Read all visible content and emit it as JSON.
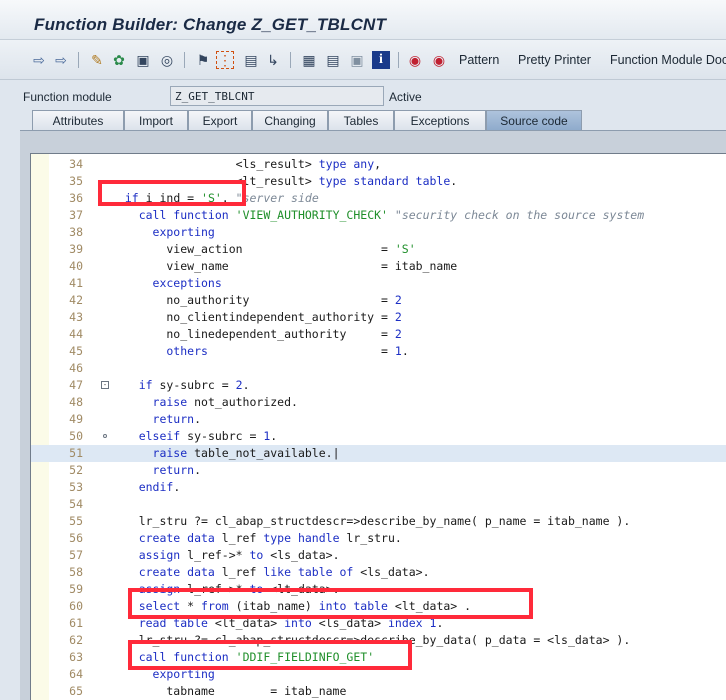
{
  "window": {
    "title": "Function Builder: Change Z_GET_TBLCNT"
  },
  "toolbar": {
    "icons": [
      "back-arrow-icon",
      "forward-arrow-icon",
      "pencil-toggle-icon",
      "other-object-icon",
      "activate-icon",
      "check-icon",
      "where-used-icon",
      "navigate-icon",
      "display-object-list-icon",
      "hierarchy-icon",
      "stack-icon",
      "documentation-icon",
      "info-icon",
      "test-icon",
      "debugger-icon"
    ],
    "pattern_label": "Pattern",
    "pretty_printer_label": "Pretty Printer",
    "function_module_doc_label": "Function Module Doc"
  },
  "header": {
    "fm_label": "Function module",
    "fm_value": "Z_GET_TBLCNT",
    "status": "Active"
  },
  "tabs": [
    {
      "label": "Attributes",
      "active": false
    },
    {
      "label": "Import",
      "active": false
    },
    {
      "label": "Export",
      "active": false
    },
    {
      "label": "Changing",
      "active": false
    },
    {
      "label": "Tables",
      "active": false
    },
    {
      "label": "Exceptions",
      "active": false
    },
    {
      "label": "Source code",
      "active": true
    }
  ],
  "colors": {
    "keyword": "#1c2ec4",
    "string": "#1f8f2a",
    "comment": "#7c8896",
    "highlight_box": "#ff2a3a",
    "line_number": "#a08a64"
  },
  "editor": {
    "lines": [
      {
        "n": "34",
        "parts": [
          [
            "tx",
            "                  <ls_result> "
          ],
          [
            "kw",
            "type"
          ],
          [
            "tx",
            " "
          ],
          [
            "kw",
            "any"
          ],
          [
            "tx",
            ","
          ]
        ]
      },
      {
        "n": "35",
        "parts": [
          [
            "tx",
            "                  <lt_result> "
          ],
          [
            "kw",
            "type standard table"
          ],
          [
            "tx",
            "."
          ]
        ]
      },
      {
        "n": "36",
        "parts": [
          [
            "kw",
            "  if"
          ],
          [
            "tx",
            " i_ind = "
          ],
          [
            "st",
            "'S'"
          ],
          [
            "tx",
            ". "
          ],
          [
            "cm",
            "\"server side"
          ]
        ]
      },
      {
        "n": "37",
        "parts": [
          [
            "kw",
            "    call function"
          ],
          [
            "tx",
            " "
          ],
          [
            "st",
            "'VIEW_AUTHORITY_CHECK'"
          ],
          [
            "tx",
            " "
          ],
          [
            "cm",
            "\"security check on the source system"
          ]
        ]
      },
      {
        "n": "38",
        "parts": [
          [
            "kw",
            "      exporting"
          ]
        ]
      },
      {
        "n": "39",
        "parts": [
          [
            "tx",
            "        view_action                    = "
          ],
          [
            "st",
            "'S'"
          ]
        ]
      },
      {
        "n": "40",
        "parts": [
          [
            "tx",
            "        view_name                      = itab_name"
          ]
        ]
      },
      {
        "n": "41",
        "parts": [
          [
            "kw",
            "      exceptions"
          ]
        ]
      },
      {
        "n": "42",
        "parts": [
          [
            "tx",
            "        no_authority                   = "
          ],
          [
            "nm",
            "2"
          ]
        ]
      },
      {
        "n": "43",
        "parts": [
          [
            "tx",
            "        no_clientindependent_authority = "
          ],
          [
            "nm",
            "2"
          ]
        ]
      },
      {
        "n": "44",
        "parts": [
          [
            "tx",
            "        no_linedependent_authority     = "
          ],
          [
            "nm",
            "2"
          ]
        ]
      },
      {
        "n": "45",
        "parts": [
          [
            "kw",
            "        others"
          ],
          [
            "tx",
            "                         = "
          ],
          [
            "nm",
            "1"
          ],
          [
            "tx",
            "."
          ]
        ]
      },
      {
        "n": "46",
        "parts": []
      },
      {
        "n": "47",
        "parts": [
          [
            "kw",
            "    if"
          ],
          [
            "tx",
            " sy-subrc = "
          ],
          [
            "nm",
            "2"
          ],
          [
            "tx",
            "."
          ]
        ]
      },
      {
        "n": "48",
        "parts": [
          [
            "kw",
            "      raise"
          ],
          [
            "tx",
            " not_authorized."
          ]
        ]
      },
      {
        "n": "49",
        "parts": [
          [
            "kw",
            "      return"
          ],
          [
            "tx",
            "."
          ]
        ]
      },
      {
        "n": "50",
        "parts": [
          [
            "kw",
            "    elseif"
          ],
          [
            "tx",
            " sy-subrc = "
          ],
          [
            "nm",
            "1"
          ],
          [
            "tx",
            "."
          ]
        ]
      },
      {
        "n": "51",
        "parts": [
          [
            "kw",
            "      raise"
          ],
          [
            "tx",
            " table_not_available.|"
          ]
        ]
      },
      {
        "n": "52",
        "parts": [
          [
            "kw",
            "      return"
          ],
          [
            "tx",
            "."
          ]
        ]
      },
      {
        "n": "53",
        "parts": [
          [
            "kw",
            "    endif"
          ],
          [
            "tx",
            "."
          ]
        ]
      },
      {
        "n": "54",
        "parts": []
      },
      {
        "n": "55",
        "parts": [
          [
            "tx",
            "    lr_stru ?= cl_abap_structdescr=>describe_by_name( p_name = itab_name )."
          ]
        ]
      },
      {
        "n": "56",
        "parts": [
          [
            "kw",
            "    create data"
          ],
          [
            "tx",
            " l_ref "
          ],
          [
            "kw",
            "type handle"
          ],
          [
            "tx",
            " lr_stru."
          ]
        ]
      },
      {
        "n": "57",
        "parts": [
          [
            "kw",
            "    assign"
          ],
          [
            "tx",
            " l_ref->* "
          ],
          [
            "kw",
            "to"
          ],
          [
            "tx",
            " <ls_data>."
          ]
        ]
      },
      {
        "n": "58",
        "parts": [
          [
            "kw",
            "    create data"
          ],
          [
            "tx",
            " l_ref "
          ],
          [
            "kw",
            "like table of"
          ],
          [
            "tx",
            " <ls_data>."
          ]
        ]
      },
      {
        "n": "59",
        "parts": [
          [
            "kw",
            "    assign"
          ],
          [
            "tx",
            " l_ref->* "
          ],
          [
            "kw",
            "to"
          ],
          [
            "tx",
            " <lt_data>."
          ]
        ]
      },
      {
        "n": "60",
        "parts": [
          [
            "kw",
            "    select"
          ],
          [
            "tx",
            " * "
          ],
          [
            "kw",
            "from"
          ],
          [
            "tx",
            " (itab_name) "
          ],
          [
            "kw",
            "into table"
          ],
          [
            "tx",
            " <lt_data> ."
          ]
        ]
      },
      {
        "n": "61",
        "parts": [
          [
            "kw",
            "    read table"
          ],
          [
            "tx",
            " <lt_data> "
          ],
          [
            "kw",
            "into"
          ],
          [
            "tx",
            " <ls_data> "
          ],
          [
            "kw",
            "index"
          ],
          [
            "tx",
            " "
          ],
          [
            "nm",
            "1"
          ],
          [
            "tx",
            "."
          ]
        ]
      },
      {
        "n": "62",
        "parts": [
          [
            "tx",
            "    lr_stru ?= cl_abap_structdescr=>describe_by_data( p_data = <ls_data> )."
          ]
        ]
      },
      {
        "n": "63",
        "parts": [
          [
            "kw",
            "    call function"
          ],
          [
            "tx",
            " "
          ],
          [
            "st",
            "'DDIF_FIELDINFO_GET'"
          ]
        ]
      },
      {
        "n": "64",
        "parts": [
          [
            "kw",
            "      exporting"
          ]
        ]
      },
      {
        "n": "65",
        "parts": [
          [
            "tx",
            "        tabname        = itab_name"
          ]
        ]
      }
    ]
  }
}
